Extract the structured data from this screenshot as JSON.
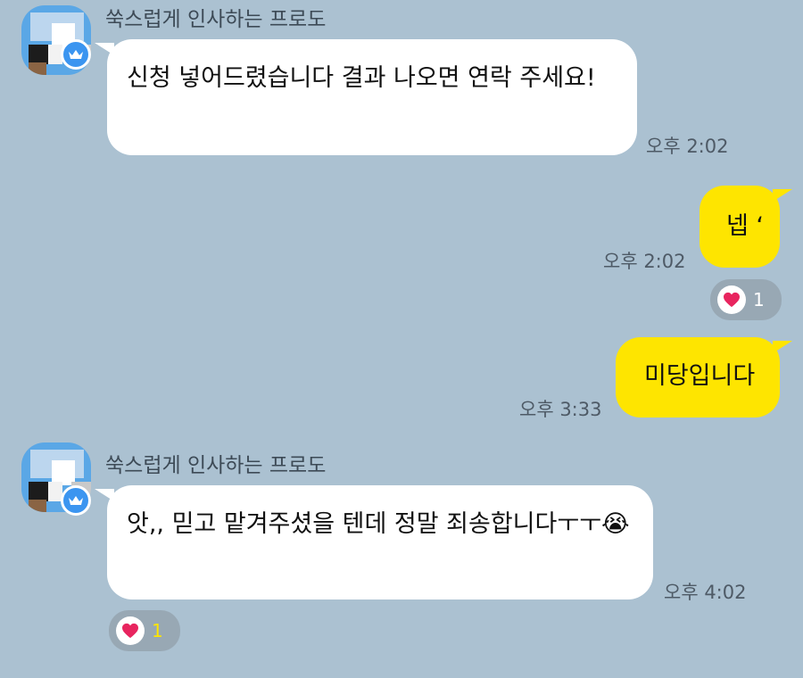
{
  "chat": {
    "sender_name": "쑥스럽게 인사하는 프로도",
    "messages": [
      {
        "text": "신청 넣어드렸습니다 결과 나오면 연락 주세요!",
        "time": "오후 2:02"
      },
      {
        "text": "넵 ‘",
        "time": "오후 2:02",
        "reaction_count": "1"
      },
      {
        "text": "미당입니다",
        "time": "오후 3:33"
      },
      {
        "text": "앗,, 믿고 맡겨주셨을 텐데 정말 죄송합니다ㅜㅜ😭",
        "time": "오후 4:02",
        "reaction_count": "1"
      }
    ]
  },
  "icons": {
    "reaction": "heart-icon",
    "avatar_badge": "crown-icon"
  },
  "colors": {
    "background": "#abc1d1",
    "outgoing_bubble": "#fee500",
    "incoming_bubble": "#ffffff",
    "heart": "#e8255f",
    "reaction_pill": "#98a8b4",
    "reaction_count_dark": "#ffffff",
    "reaction_count_light": "#fee500"
  }
}
